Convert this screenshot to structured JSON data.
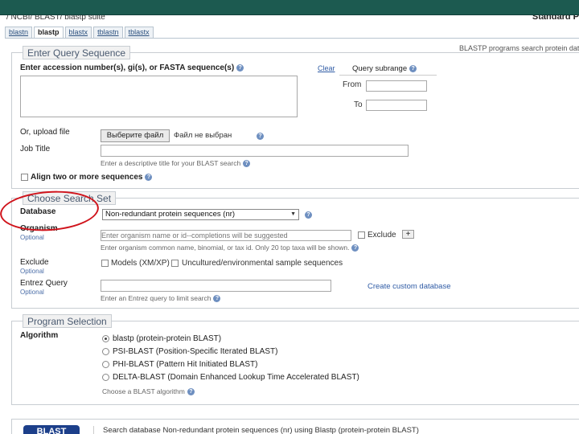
{
  "header": {
    "breadcrumb": "/ NCBI/ BLAST/ blastp suite",
    "right_title": "Standard P"
  },
  "tabs": [
    {
      "label": "blastn"
    },
    {
      "label": "blastp",
      "active": true
    },
    {
      "label": "blastx"
    },
    {
      "label": "tblastn"
    },
    {
      "label": "tblastx"
    }
  ],
  "program_note": "BLASTP programs search protein data",
  "query": {
    "legend": "Enter Query Sequence",
    "accession_label": "Enter accession number(s), gi(s), or FASTA sequence(s)",
    "accession_value": "",
    "clear_link": "Clear",
    "subrange_label": "Query subrange",
    "from_label": "From",
    "from_value": "",
    "to_label": "To",
    "to_value": "",
    "upload_label": "Or, upload file",
    "file_button": "Выберите файл",
    "file_status": "Файл не выбран",
    "job_title_label": "Job Title",
    "job_title_value": "",
    "job_title_hint": "Enter a descriptive title for your BLAST search",
    "align_label": "Align two or more sequences"
  },
  "search_set": {
    "legend": "Choose Search Set",
    "database_label": "Database",
    "database_value": "Non-redundant protein sequences (nr)",
    "organism_label": "Organism",
    "organism_optional": "Optional",
    "organism_placeholder": "Enter organism name or id--completions will be suggested",
    "organism_exclude": "Exclude",
    "organism_add": "+",
    "organism_hint": "Enter organism common name, binomial, or tax id. Only 20 top taxa will be shown.",
    "exclude_label": "Exclude",
    "exclude_optional": "Optional",
    "exclude_models": "Models (XM/XP)",
    "exclude_uncultured": "Uncultured/environmental sample sequences",
    "entrez_label": "Entrez Query",
    "entrez_optional": "Optional",
    "entrez_value": "",
    "custom_db_link": "Create custom database",
    "entrez_hint": "Enter an Entrez query to limit search"
  },
  "program": {
    "legend": "Program Selection",
    "algorithm_label": "Algorithm",
    "options": [
      {
        "label": "blastp (protein-protein BLAST)",
        "selected": true
      },
      {
        "label": "PSI-BLAST (Position-Specific Iterated BLAST)",
        "selected": false
      },
      {
        "label": "PHI-BLAST (Pattern Hit Initiated BLAST)",
        "selected": false
      },
      {
        "label": "DELTA-BLAST (Domain Enhanced Lookup Time Accelerated BLAST)",
        "selected": false
      }
    ],
    "hint": "Choose a BLAST algorithm"
  },
  "footer": {
    "blast_button": "BLAST",
    "summary": "Search database Non-redundant protein sequences (nr) using Blastp (protein-protein BLAST)"
  },
  "help_icon": "?",
  "colors": {
    "header_bar": "#1c5a50",
    "link": "#2f5ba5",
    "blast_button": "#1c3f8a",
    "annotation_circle": "#d0141c"
  }
}
